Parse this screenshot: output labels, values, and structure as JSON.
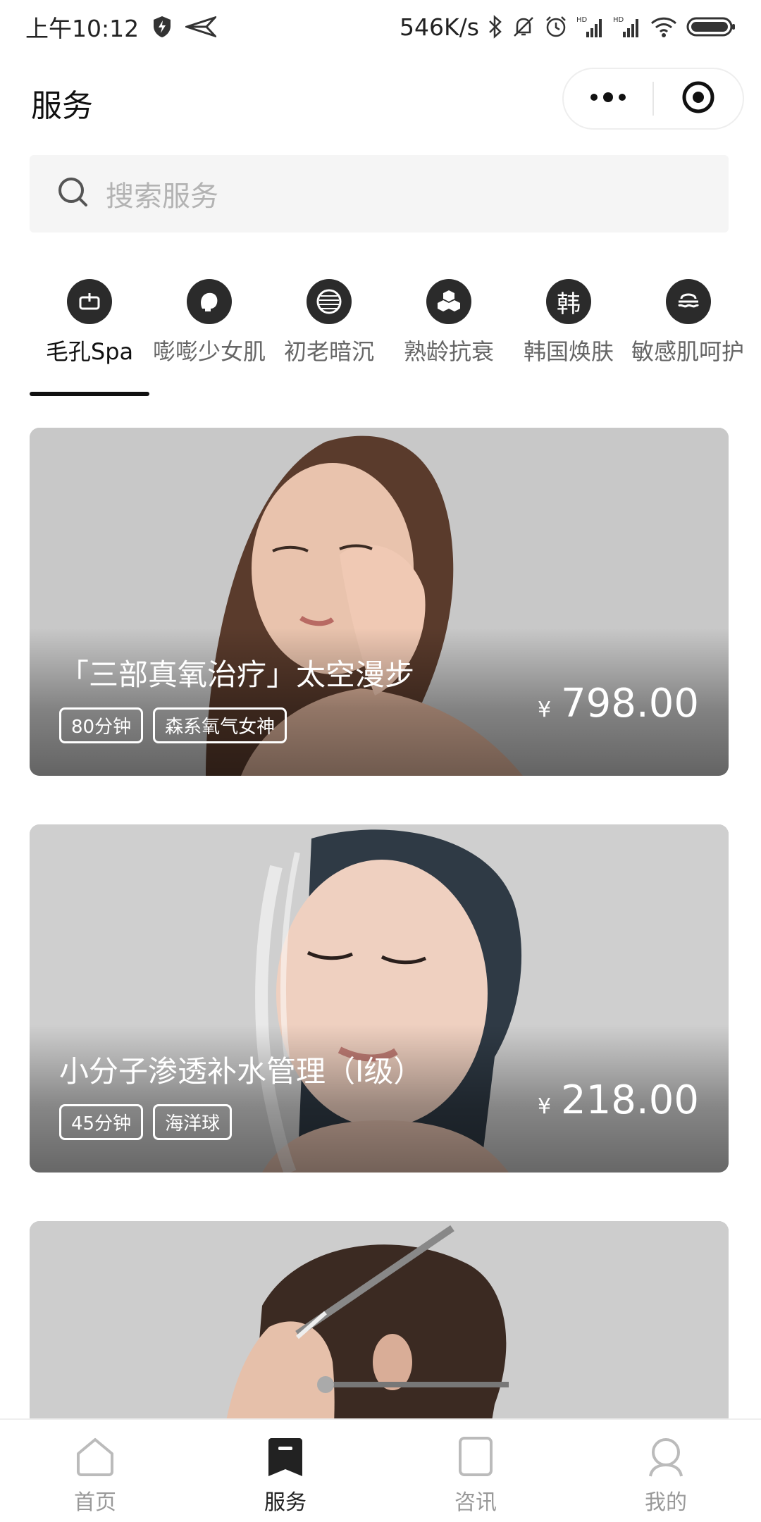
{
  "status_bar": {
    "time": "上午10:12",
    "network_speed": "546K/s",
    "icons": [
      "shield-bolt-icon",
      "send-arrow-icon",
      "bluetooth-icon",
      "bell-off-icon",
      "alarm-icon",
      "signal-hd-icon",
      "signal-hd-icon",
      "wifi-icon",
      "battery-icon"
    ]
  },
  "header": {
    "title": "服务",
    "menu_icon": "more-dots-icon",
    "close_icon": "target-circle-icon"
  },
  "search": {
    "placeholder": "搜索服务",
    "icon": "search-icon"
  },
  "categories": [
    {
      "label": "毛孔Spa",
      "icon": "pore-icon",
      "active": true
    },
    {
      "label": "嘭嘭少女肌",
      "icon": "face-head-icon",
      "active": false
    },
    {
      "label": "初老暗沉",
      "icon": "striped-circle-icon",
      "active": false
    },
    {
      "label": "熟龄抗衰",
      "icon": "hexagon-cells-icon",
      "active": false
    },
    {
      "label": "韩国焕肤",
      "icon": "korea-char-icon",
      "glyph": "韩",
      "active": false
    },
    {
      "label": "敏感肌呵护",
      "icon": "calm-waves-icon",
      "active": false
    }
  ],
  "services": [
    {
      "title": "「三部真氧治疗」太空漫步",
      "tags": [
        "80分钟",
        "森系氧气女神"
      ],
      "currency": "¥",
      "price": "798.00"
    },
    {
      "title": "小分子渗透补水管理（I级）",
      "tags": [
        "45分钟",
        "海洋球"
      ],
      "currency": "¥",
      "price": "218.00"
    },
    {
      "title": "",
      "tags": [],
      "currency": "",
      "price": ""
    }
  ],
  "bottom_nav": [
    {
      "label": "首页",
      "icon": "home-icon",
      "active": false
    },
    {
      "label": "服务",
      "icon": "bookmark-icon",
      "active": true
    },
    {
      "label": "咨讯",
      "icon": "document-icon",
      "active": false
    },
    {
      "label": "我的",
      "icon": "user-icon",
      "active": false
    }
  ],
  "colors": {
    "primary": "#222222",
    "search_bg": "#f5f5f5",
    "inactive_text": "#999999"
  }
}
